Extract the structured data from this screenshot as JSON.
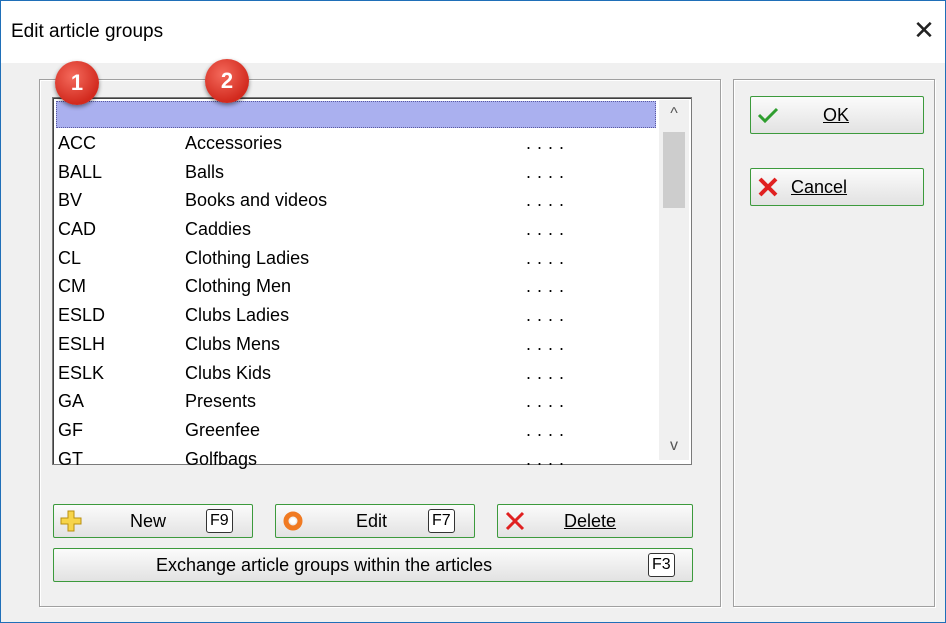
{
  "window": {
    "title": "Edit article groups",
    "close_glyph": "✕"
  },
  "badges": [
    "1",
    "2"
  ],
  "list": {
    "rows": [
      {
        "code": "ACC",
        "name": "Accessories",
        "dots": "...."
      },
      {
        "code": "BALL",
        "name": "Balls",
        "dots": "...."
      },
      {
        "code": "BV",
        "name": "Books and videos",
        "dots": "...."
      },
      {
        "code": "CAD",
        "name": "Caddies",
        "dots": "...."
      },
      {
        "code": "CL",
        "name": "Clothing Ladies",
        "dots": "...."
      },
      {
        "code": "CM",
        "name": "Clothing Men",
        "dots": "...."
      },
      {
        "code": "ESLD",
        "name": "Clubs Ladies",
        "dots": "...."
      },
      {
        "code": "ESLH",
        "name": "Clubs Mens",
        "dots": "...."
      },
      {
        "code": "ESLK",
        "name": "Clubs Kids",
        "dots": "...."
      },
      {
        "code": "GA",
        "name": "Presents",
        "dots": "...."
      },
      {
        "code": "GF",
        "name": "Greenfee",
        "dots": "...."
      },
      {
        "code": "GT",
        "name": "Golfbags",
        "dots": "...."
      }
    ],
    "scroll_up": "^",
    "scroll_down": "v"
  },
  "buttons": {
    "new": {
      "label": "New",
      "fkey": "F9"
    },
    "edit": {
      "label": "Edit",
      "fkey": "F7"
    },
    "delete": {
      "label": "Delete"
    },
    "exchange": {
      "label": "Exchange article groups within the articles",
      "fkey": "F3"
    },
    "ok": {
      "label": "OK"
    },
    "cancel": {
      "label": "Cancel"
    }
  },
  "colors": {
    "accent_border": "#3c9a3c",
    "selected_row": "#aab0ef",
    "badge": "#d22a1e"
  }
}
